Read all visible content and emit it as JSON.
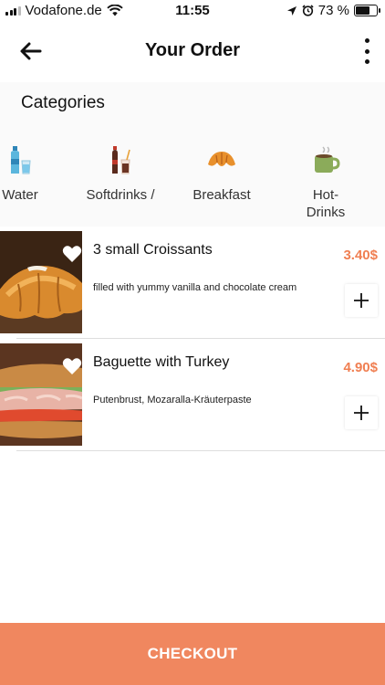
{
  "status_bar": {
    "carrier": "Vodafone.de",
    "time": "11:55",
    "battery_percent": "73 %",
    "battery_level": 0.73,
    "icons": [
      "signal-icon",
      "wifi-icon",
      "location-icon",
      "alarm-icon",
      "battery-icon"
    ]
  },
  "header": {
    "title": "Your Order",
    "back_icon": "arrow-left-icon",
    "menu_icon": "more-vertical-icon"
  },
  "categories": {
    "title": "Categories",
    "items": [
      {
        "label": "Water",
        "icon": "water-bottle-icon"
      },
      {
        "label": "Softdrinks /",
        "icon": "soda-bottle-icon"
      },
      {
        "label": "Breakfast",
        "icon": "croissant-icon"
      },
      {
        "label": "Hot-Drinks",
        "icon": "coffee-cup-icon"
      }
    ]
  },
  "products": [
    {
      "name": "3 small Croissants",
      "description": "filled with yummy vanilla and chocolate cream",
      "price": "3.40$",
      "favorite_icon": "heart-icon",
      "add_icon": "plus-icon"
    },
    {
      "name": "Baguette with Turkey",
      "description": "Putenbrust, Mozaralla-Kräuterpaste",
      "price": "4.90$",
      "favorite_icon": "heart-icon",
      "add_icon": "plus-icon"
    }
  ],
  "checkout": {
    "label": "CHECKOUT"
  },
  "colors": {
    "accent": "#f0875f",
    "price": "#f07f52",
    "category_bg": "#fafafa"
  }
}
